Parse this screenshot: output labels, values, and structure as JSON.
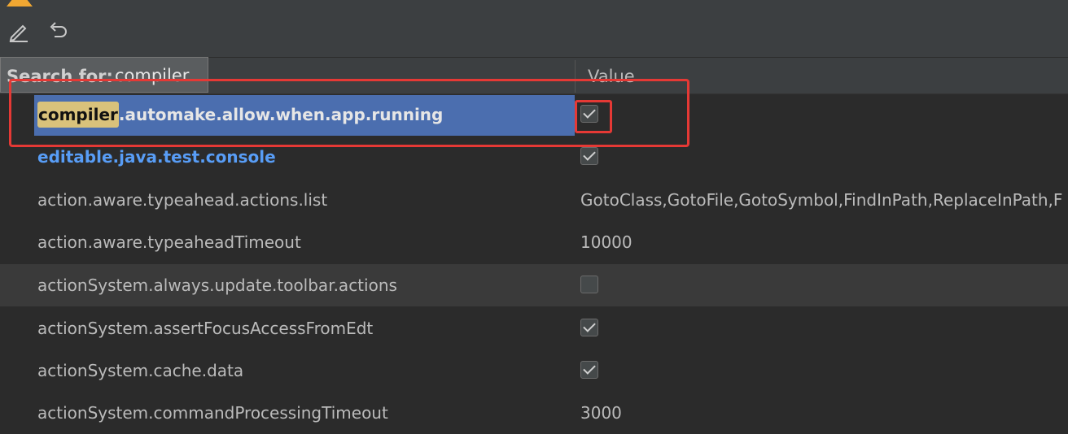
{
  "toolbar": {
    "edit_icon": "pencil-icon",
    "undo_icon": "undo-icon"
  },
  "search": {
    "label": "Search for:",
    "value": "compiler"
  },
  "table": {
    "value_header": "Value",
    "rows": [
      {
        "name_highlight": "compiler",
        "name_rest": ".automake.allow.when.app.running",
        "type": "checkbox",
        "checked": true,
        "selected": true
      },
      {
        "name": "editable.java.test.console",
        "type": "checkbox",
        "checked": true,
        "modified": true
      },
      {
        "name": "action.aware.typeahead.actions.list",
        "type": "text",
        "value": "GotoClass,GotoFile,GotoSymbol,FindInPath,ReplaceInPath,F"
      },
      {
        "name": "action.aware.typeaheadTimeout",
        "type": "text",
        "value": "10000"
      },
      {
        "name": "actionSystem.always.update.toolbar.actions",
        "type": "checkbox",
        "checked": false
      },
      {
        "name": "actionSystem.assertFocusAccessFromEdt",
        "type": "checkbox",
        "checked": true
      },
      {
        "name": "actionSystem.cache.data",
        "type": "checkbox",
        "checked": true
      },
      {
        "name": "actionSystem.commandProcessingTimeout",
        "type": "text",
        "value": "3000"
      }
    ]
  },
  "colors": {
    "selection": "#4b6eaf",
    "match_highlight": "#d9c27b",
    "modified_text": "#589df6",
    "annotation": "#e53935"
  }
}
